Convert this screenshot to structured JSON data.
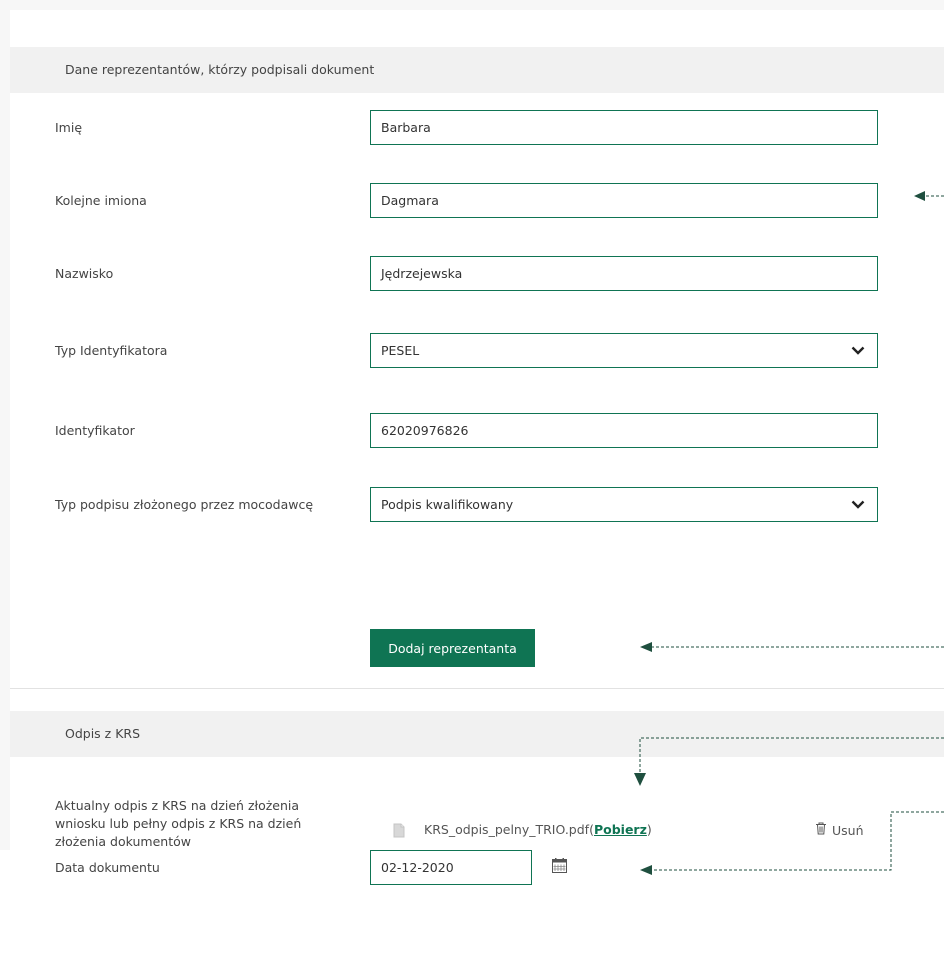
{
  "section_representatives": {
    "title": "Dane reprezentantów, którzy podpisali dokument",
    "fields": {
      "first_name": {
        "label": "Imię",
        "value": "Barbara"
      },
      "middle_names": {
        "label": "Kolejne imiona",
        "value": "Dagmara"
      },
      "last_name": {
        "label": "Nazwisko",
        "value": "Jędrzejewska"
      },
      "id_type": {
        "label": "Typ Identyfikatora",
        "value": "PESEL"
      },
      "identifier": {
        "label": "Identyfikator",
        "value": "62020976826"
      },
      "signature_type": {
        "label": "Typ podpisu złożonego przez mocodawcę",
        "value": "Podpis kwalifikowany"
      }
    },
    "add_button": "Dodaj reprezentanta"
  },
  "section_krs": {
    "title": "Odpis z KRS",
    "extract_label_lines": [
      "Aktualny odpis z KRS na dzień złożenia",
      "wniosku lub pełny odpis z KRS na dzień",
      "złożenia dokumentów"
    ],
    "file_name": "KRS_odpis_pelny_TRIO.pdf",
    "download_open": "(",
    "download_link": "Pobierz",
    "download_close": ")",
    "delete_label": "Usuń",
    "date_label": "Data dokumentu",
    "date_value": "02-12-2020"
  },
  "colors": {
    "accent": "#0f7453",
    "header_bg": "#f1f1f1",
    "annotation": "#1f4f3f"
  },
  "icons": [
    "chevron-down-icon",
    "file-icon",
    "trash-icon",
    "calendar-icon",
    "arrow-left-icon",
    "arrow-down-icon"
  ]
}
